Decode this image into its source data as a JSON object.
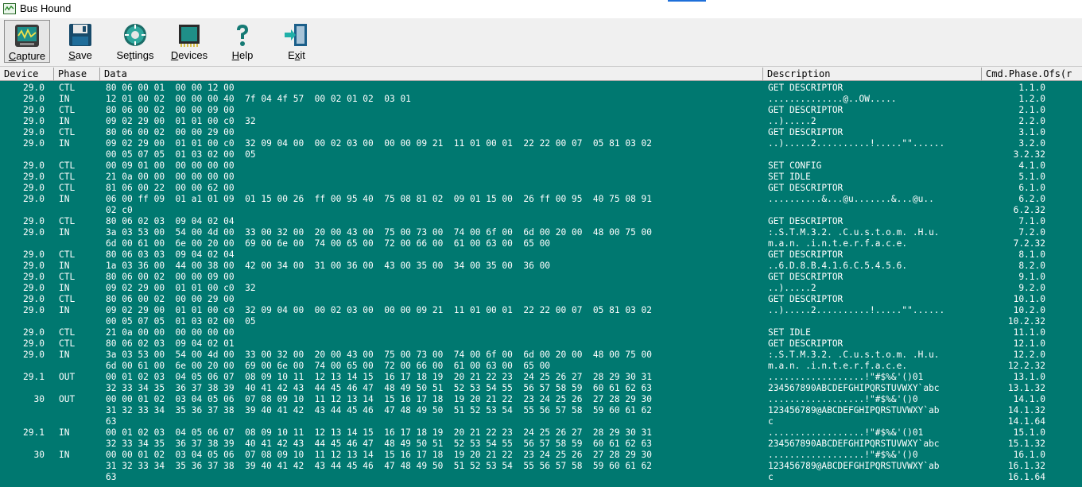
{
  "window": {
    "title": "Bus Hound"
  },
  "toolbar": {
    "capture": {
      "pre": "",
      "u": "C",
      "post": "apture"
    },
    "save": {
      "pre": "",
      "u": "S",
      "post": "ave"
    },
    "settings": {
      "pre": "Se",
      "u": "t",
      "post": "tings"
    },
    "devices": {
      "pre": "",
      "u": "D",
      "post": "evices"
    },
    "help": {
      "pre": "",
      "u": "H",
      "post": "elp"
    },
    "exit": {
      "pre": "E",
      "u": "x",
      "post": "it"
    }
  },
  "table": {
    "headers": [
      "Device",
      "Phase",
      "Data",
      "Description",
      "Cmd.Phase.Ofs(r"
    ],
    "rows": [
      {
        "device": "29.0",
        "phase": "CTL",
        "data": [
          "80 06 00 01  00 00 12 00"
        ],
        "desc": [
          "GET DESCRIPTOR"
        ],
        "cmd": [
          "1.1.0"
        ]
      },
      {
        "device": "29.0",
        "phase": "IN",
        "data": [
          "12 01 00 02  00 00 00 40  7f 04 4f 57  00 02 01 02  03 01"
        ],
        "desc": [
          "..............@..OW....."
        ],
        "cmd": [
          "1.2.0"
        ]
      },
      {
        "device": "29.0",
        "phase": "CTL",
        "data": [
          "80 06 00 02  00 00 09 00"
        ],
        "desc": [
          "GET DESCRIPTOR"
        ],
        "cmd": [
          "2.1.0"
        ]
      },
      {
        "device": "29.0",
        "phase": "IN",
        "data": [
          "09 02 29 00  01 01 00 c0  32"
        ],
        "desc": [
          "..).....2"
        ],
        "cmd": [
          "2.2.0"
        ]
      },
      {
        "device": "29.0",
        "phase": "CTL",
        "data": [
          "80 06 00 02  00 00 29 00"
        ],
        "desc": [
          "GET DESCRIPTOR"
        ],
        "cmd": [
          "3.1.0"
        ]
      },
      {
        "device": "29.0",
        "phase": "IN",
        "data": [
          "09 02 29 00  01 01 00 c0  32 09 04 00  00 02 03 00  00 00 09 21  11 01 00 01  22 22 00 07  05 81 03 02",
          "00 05 07 05  01 03 02 00  05"
        ],
        "desc": [
          "..).....2..........!.....\"\"......",
          ""
        ],
        "cmd": [
          "3.2.0",
          "3.2.32"
        ]
      },
      {
        "device": "29.0",
        "phase": "CTL",
        "data": [
          "00 09 01 00  00 00 00 00"
        ],
        "desc": [
          "SET CONFIG"
        ],
        "cmd": [
          "4.1.0"
        ]
      },
      {
        "device": "29.0",
        "phase": "CTL",
        "data": [
          "21 0a 00 00  00 00 00 00"
        ],
        "desc": [
          "SET IDLE"
        ],
        "cmd": [
          "5.1.0"
        ]
      },
      {
        "device": "29.0",
        "phase": "CTL",
        "data": [
          "81 06 00 22  00 00 62 00"
        ],
        "desc": [
          "GET DESCRIPTOR"
        ],
        "cmd": [
          "6.1.0"
        ]
      },
      {
        "device": "29.0",
        "phase": "IN",
        "data": [
          "06 00 ff 09  01 a1 01 09  01 15 00 26  ff 00 95 40  75 08 81 02  09 01 15 00  26 ff 00 95  40 75 08 91",
          "02 c0"
        ],
        "desc": [
          "..........&...@u.......&...@u..",
          ""
        ],
        "cmd": [
          "6.2.0",
          "6.2.32"
        ]
      },
      {
        "device": "29.0",
        "phase": "CTL",
        "data": [
          "80 06 02 03  09 04 02 04"
        ],
        "desc": [
          "GET DESCRIPTOR"
        ],
        "cmd": [
          "7.1.0"
        ]
      },
      {
        "device": "29.0",
        "phase": "IN",
        "data": [
          "3a 03 53 00  54 00 4d 00  33 00 32 00  20 00 43 00  75 00 73 00  74 00 6f 00  6d 00 20 00  48 00 75 00",
          "6d 00 61 00  6e 00 20 00  69 00 6e 00  74 00 65 00  72 00 66 00  61 00 63 00  65 00"
        ],
        "desc": [
          ":.S.T.M.3.2. .C.u.s.t.o.m. .H.u.",
          "m.a.n. .i.n.t.e.r.f.a.c.e."
        ],
        "cmd": [
          "7.2.0",
          "7.2.32"
        ]
      },
      {
        "device": "29.0",
        "phase": "CTL",
        "data": [
          "80 06 03 03  09 04 02 04"
        ],
        "desc": [
          "GET DESCRIPTOR"
        ],
        "cmd": [
          "8.1.0"
        ]
      },
      {
        "device": "29.0",
        "phase": "IN",
        "data": [
          "1a 03 36 00  44 00 38 00  42 00 34 00  31 00 36 00  43 00 35 00  34 00 35 00  36 00"
        ],
        "desc": [
          "..6.D.8.B.4.1.6.C.5.4.5.6."
        ],
        "cmd": [
          "8.2.0"
        ]
      },
      {
        "device": "29.0",
        "phase": "CTL",
        "data": [
          "80 06 00 02  00 00 09 00"
        ],
        "desc": [
          "GET DESCRIPTOR"
        ],
        "cmd": [
          "9.1.0"
        ]
      },
      {
        "device": "29.0",
        "phase": "IN",
        "data": [
          "09 02 29 00  01 01 00 c0  32"
        ],
        "desc": [
          "..).....2"
        ],
        "cmd": [
          "9.2.0"
        ]
      },
      {
        "device": "29.0",
        "phase": "CTL",
        "data": [
          "80 06 00 02  00 00 29 00"
        ],
        "desc": [
          "GET DESCRIPTOR"
        ],
        "cmd": [
          "10.1.0"
        ]
      },
      {
        "device": "29.0",
        "phase": "IN",
        "data": [
          "09 02 29 00  01 01 00 c0  32 09 04 00  00 02 03 00  00 00 09 21  11 01 00 01  22 22 00 07  05 81 03 02",
          "00 05 07 05  01 03 02 00  05"
        ],
        "desc": [
          "..).....2..........!.....\"\"......",
          ""
        ],
        "cmd": [
          "10.2.0",
          "10.2.32"
        ]
      },
      {
        "device": "29.0",
        "phase": "CTL",
        "data": [
          "21 0a 00 00  00 00 00 00"
        ],
        "desc": [
          "SET IDLE"
        ],
        "cmd": [
          "11.1.0"
        ]
      },
      {
        "device": "29.0",
        "phase": "CTL",
        "data": [
          "80 06 02 03  09 04 02 01"
        ],
        "desc": [
          "GET DESCRIPTOR"
        ],
        "cmd": [
          "12.1.0"
        ]
      },
      {
        "device": "29.0",
        "phase": "IN",
        "data": [
          "3a 03 53 00  54 00 4d 00  33 00 32 00  20 00 43 00  75 00 73 00  74 00 6f 00  6d 00 20 00  48 00 75 00",
          "6d 00 61 00  6e 00 20 00  69 00 6e 00  74 00 65 00  72 00 66 00  61 00 63 00  65 00"
        ],
        "desc": [
          ":.S.T.M.3.2. .C.u.s.t.o.m. .H.u.",
          "m.a.n. .i.n.t.e.r.f.a.c.e."
        ],
        "cmd": [
          "12.2.0",
          "12.2.32"
        ]
      },
      {
        "device": "29.1",
        "phase": "OUT",
        "data": [
          "00 01 02 03  04 05 06 07  08 09 10 11  12 13 14 15  16 17 18 19  20 21 22 23  24 25 26 27  28 29 30 31",
          "32 33 34 35  36 37 38 39  40 41 42 43  44 45 46 47  48 49 50 51  52 53 54 55  56 57 58 59  60 61 62 63"
        ],
        "desc": [
          "..................!\"#$%&'()01",
          "234567890ABCDEFGHIPQRSTUVWXY`abc"
        ],
        "cmd": [
          "13.1.0",
          "13.1.32"
        ]
      },
      {
        "device": "30",
        "phase": "OUT",
        "data": [
          "00 00 01 02  03 04 05 06  07 08 09 10  11 12 13 14  15 16 17 18  19 20 21 22  23 24 25 26  27 28 29 30",
          "31 32 33 34  35 36 37 38  39 40 41 42  43 44 45 46  47 48 49 50  51 52 53 54  55 56 57 58  59 60 61 62",
          "63"
        ],
        "desc": [
          "..................!\"#$%&'()0",
          "123456789@ABCDEFGHIPQRSTUVWXY`ab",
          "c"
        ],
        "cmd": [
          "14.1.0",
          "14.1.32",
          "14.1.64"
        ]
      },
      {
        "device": "29.1",
        "phase": "IN",
        "data": [
          "00 01 02 03  04 05 06 07  08 09 10 11  12 13 14 15  16 17 18 19  20 21 22 23  24 25 26 27  28 29 30 31",
          "32 33 34 35  36 37 38 39  40 41 42 43  44 45 46 47  48 49 50 51  52 53 54 55  56 57 58 59  60 61 62 63"
        ],
        "desc": [
          "..................!\"#$%&'()01",
          "234567890ABCDEFGHIPQRSTUVWXY`abc"
        ],
        "cmd": [
          "15.1.0",
          "15.1.32"
        ]
      },
      {
        "device": "30",
        "phase": "IN",
        "data": [
          "00 00 01 02  03 04 05 06  07 08 09 10  11 12 13 14  15 16 17 18  19 20 21 22  23 24 25 26  27 28 29 30",
          "31 32 33 34  35 36 37 38  39 40 41 42  43 44 45 46  47 48 49 50  51 52 53 54  55 56 57 58  59 60 61 62",
          "63"
        ],
        "desc": [
          "..................!\"#$%&'()0",
          "123456789@ABCDEFGHIPQRSTUVWXY`ab",
          "c"
        ],
        "cmd": [
          "16.1.0",
          "16.1.32",
          "16.1.64"
        ]
      }
    ]
  }
}
